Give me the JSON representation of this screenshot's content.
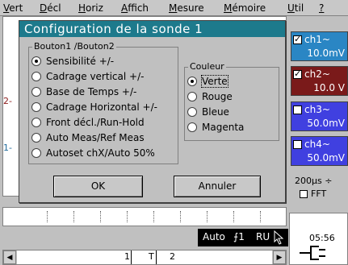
{
  "menubar": {
    "items": [
      {
        "first": "V",
        "rest": "ert"
      },
      {
        "first": "D",
        "rest": "écl"
      },
      {
        "first": "H",
        "rest": "oriz"
      },
      {
        "first": "A",
        "rest": "ffich"
      },
      {
        "first": "M",
        "rest": "esure"
      },
      {
        "first": "M",
        "rest": "émoire"
      },
      {
        "first": "U",
        "rest": "til"
      },
      {
        "first": "?",
        "rest": ""
      }
    ]
  },
  "dialog": {
    "title": "Configuration de la sonde 1",
    "group1": {
      "legend": "Bouton1 /Bouton2",
      "options": [
        {
          "label": "Sensibilité +/-",
          "selected": true
        },
        {
          "label": "Cadrage vertical +/-",
          "selected": false
        },
        {
          "label": "Base de Temps +/-",
          "selected": false
        },
        {
          "label": "Cadrage Horizontal +/-",
          "selected": false
        },
        {
          "label": "Front décl./Run-Hold",
          "selected": false
        },
        {
          "label": "Auto Meas/Ref Meas",
          "selected": false
        },
        {
          "label": "Autoset chX/Auto 50%",
          "selected": false
        }
      ]
    },
    "group2": {
      "legend": "Couleur",
      "options": [
        {
          "label": "Verte",
          "selected": true
        },
        {
          "label": "Rouge",
          "selected": false
        },
        {
          "label": "Bleue",
          "selected": false
        },
        {
          "label": "Magenta",
          "selected": false
        }
      ]
    },
    "ok_label": "OK",
    "cancel_label": "Annuler"
  },
  "screen_markers": {
    "m2": "2-",
    "m1": "1-"
  },
  "channels": [
    {
      "name": "ch1~",
      "value": "10.0mV",
      "checked": true,
      "color": "#2a86c4"
    },
    {
      "name": "ch2~",
      "value": "10.0 V",
      "checked": true,
      "color": "#7a1a1a"
    },
    {
      "name": "ch3~",
      "value": "50.0mV",
      "checked": false,
      "color": "#4040e0"
    },
    {
      "name": "ch4~",
      "value": "50.0mV",
      "checked": false,
      "color": "#4040e0"
    }
  ],
  "timebase": {
    "value": "200µs",
    "symbol": "÷"
  },
  "fft_label": "FFT",
  "clock": "05:56",
  "status": {
    "mode": "Auto",
    "trigger": "⨍1",
    "state": "RU"
  },
  "scroll_markers": [
    "1",
    "T",
    "2"
  ]
}
